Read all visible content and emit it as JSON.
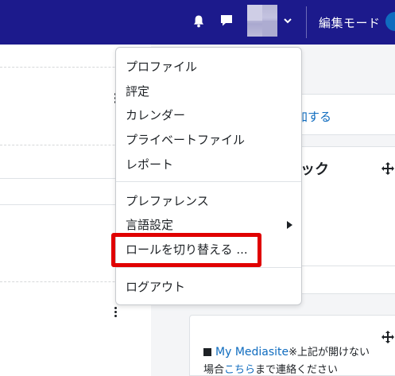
{
  "navbar": {
    "background": "#1c1a8c",
    "notifications_icon": "bell-icon",
    "messages_icon": "chat-icon",
    "user_menu_caret_icon": "chevron-down-icon",
    "edit_mode_label": "編集モード"
  },
  "user_menu": {
    "items": [
      {
        "label": "プロファイル"
      },
      {
        "label": "評定"
      },
      {
        "label": "カレンダー"
      },
      {
        "label": "プライベートファイル"
      },
      {
        "label": "レポート"
      },
      {
        "label": "プレファレンス"
      },
      {
        "label": "言語設定"
      },
      {
        "label": "ロールを切り替える ..."
      },
      {
        "label": "ログアウト"
      }
    ],
    "highlight_color": "#e00000"
  },
  "page": {
    "right_card1_link": "加する",
    "right_card2_title": "ック",
    "mediasite_link": "My Mediasite",
    "mediasite_note": "※上記が開けない",
    "contact_prefix": "場合",
    "contact_link": "こちら",
    "contact_suffix": "まで連絡ください"
  }
}
